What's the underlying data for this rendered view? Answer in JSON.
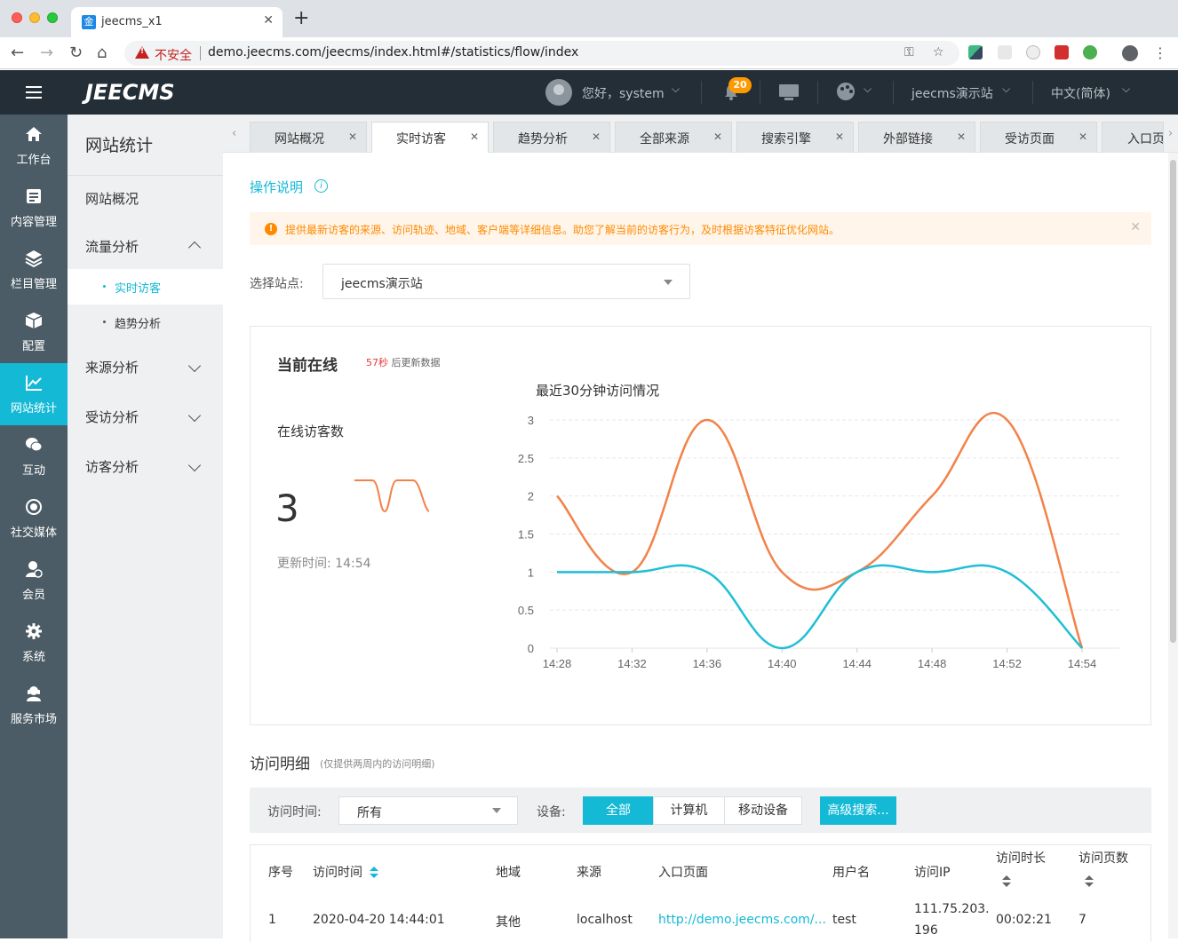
{
  "browser": {
    "tab_title": "jeecms_x1",
    "tab_favicon": "金",
    "insecure_label": "不安全",
    "url": "demo.jeecms.com/jeecms/index.html#/statistics/flow/index"
  },
  "header": {
    "logo": "JEECMS",
    "greeting": "您好，system",
    "notification_count": "20",
    "site_name": "jeecms演示站",
    "language": "中文(简体)"
  },
  "rail": [
    {
      "label": "工作台",
      "icon": "home-icon"
    },
    {
      "label": "内容管理",
      "icon": "document-icon"
    },
    {
      "label": "栏目管理",
      "icon": "layers-icon"
    },
    {
      "label": "配置",
      "icon": "cube-icon"
    },
    {
      "label": "网站统计",
      "icon": "line-chart-icon"
    },
    {
      "label": "互动",
      "icon": "chat-icon"
    },
    {
      "label": "社交媒体",
      "icon": "target-icon"
    },
    {
      "label": "会员",
      "icon": "member-icon"
    },
    {
      "label": "系统",
      "icon": "gear-icon"
    },
    {
      "label": "服务市场",
      "icon": "service-icon"
    }
  ],
  "subnav": {
    "title": "网站统计",
    "overview": "网站概况",
    "flow": "流量分析",
    "flow_children": [
      "实时访客",
      "趋势分析"
    ],
    "source": "来源分析",
    "visited": "受访分析",
    "visitor": "访客分析"
  },
  "tabs": [
    "网站概况",
    "实时访客",
    "趋势分析",
    "全部来源",
    "搜索引擎",
    "外部链接",
    "受访页面",
    "入口页"
  ],
  "main": {
    "help_link": "操作说明",
    "notice": "提供最新访客的来源、访问轨迹、地域、客户端等详细信息。助您了解当前的访客行为，及时根据访客特征优化网站。",
    "site_label": "选择站点:",
    "site_value": "jeecms演示站",
    "online": {
      "title": "当前在线",
      "countdown_sec": "57秒",
      "countdown_rest": "后更新数据",
      "visitors_label": "在线访客数",
      "visitors_count": "3",
      "update_time_label": "更新时间:",
      "update_time": "14:54"
    },
    "detail": {
      "title": "访问明细",
      "subtitle": "(仅提供两周内的访问明细)",
      "time_label": "访问时间:",
      "time_value": "所有",
      "device_label": "设备:",
      "devices": [
        "全部",
        "计算机",
        "移动设备"
      ],
      "advanced_search": "高级搜索...",
      "columns": [
        "序号",
        "访问时间",
        "地域",
        "来源",
        "入口页面",
        "用户名",
        "访问IP",
        "访问时长",
        "访问页数"
      ],
      "rows": [
        {
          "no": "1",
          "time": "2020-04-20 14:44:01",
          "region": "其他",
          "source": "localhost",
          "entry": "http://demo.jeecms.com/...",
          "user": "test",
          "ip1": "111.75.203.",
          "ip2": "196",
          "duration": "00:02:21",
          "pages": "7"
        }
      ]
    }
  },
  "colors": {
    "accent": "#14b9d6",
    "orange": "#f28249",
    "rail": "#4c5c66",
    "header": "#232e36"
  },
  "chart_data": {
    "type": "line",
    "title": "最近30分钟访问情况",
    "x": [
      "14:28",
      "14:32",
      "14:36",
      "14:40",
      "14:44",
      "14:48",
      "14:52",
      "14:54"
    ],
    "ylim": [
      0,
      3
    ],
    "yticks": [
      "0",
      "0.5",
      "1",
      "1.5",
      "2",
      "2.5",
      "3"
    ],
    "series": [
      {
        "color": "#f28249",
        "values": [
          2,
          1,
          3,
          1,
          1,
          2,
          3,
          0
        ]
      },
      {
        "color": "#1ebfd6",
        "values": [
          1,
          1,
          1,
          0,
          1,
          1,
          1,
          0
        ]
      }
    ],
    "grid": true
  },
  "sparkline": {
    "values": [
      3,
      3,
      2,
      3,
      3,
      2
    ]
  }
}
